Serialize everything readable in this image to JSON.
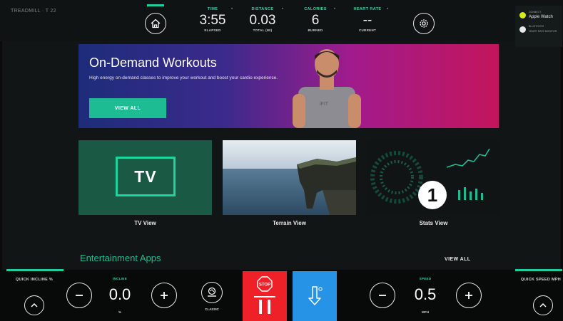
{
  "console": {
    "label": "TREADMILL · T 22"
  },
  "metrics": [
    {
      "label": "TIME",
      "value": "3:55",
      "sub": "ELAPSED"
    },
    {
      "label": "DISTANCE",
      "value": "0.03",
      "sub": "TOTAL (MI)"
    },
    {
      "label": "CALORIES",
      "value": "6",
      "sub": "BURNED"
    },
    {
      "label": "HEART RATE",
      "value": "--",
      "sub": "CURRENT"
    }
  ],
  "watch": {
    "apple_watch_small": "CONNECT",
    "apple_watch": "Apple Watch",
    "heart_small": "BLUETOOTH",
    "heart": "HEART RATE MONITOR"
  },
  "hero": {
    "title": "On-Demand Workouts",
    "description": "High energy on-demand classes to improve your workout and boost your cardio experience.",
    "button": "VIEW ALL",
    "shirt_text": "iFIT"
  },
  "tiles": [
    {
      "label": "TV View",
      "badge": "TV"
    },
    {
      "label": "Terrain View"
    },
    {
      "label": "Stats View"
    }
  ],
  "stats_badge": "1",
  "entertainment": {
    "title": "Entertainment Apps",
    "view_all": "VIEW ALL"
  },
  "controls": {
    "quick_incline": "QUICK INCLINE %",
    "incline_label": "INCLINE",
    "incline_value": "0.0",
    "incline_unit": "%",
    "classic": "CLASSIC",
    "stop": "STOP",
    "speed_label": "SPEED",
    "speed_value": "0.5",
    "speed_unit": "MPH",
    "quick_speed": "QUICK SPEED MPH"
  },
  "colors": {
    "accent": "#1ecfa0",
    "stop": "#ee2028",
    "cooldown": "#2793e6",
    "tv_tile": "#1a5a45"
  }
}
